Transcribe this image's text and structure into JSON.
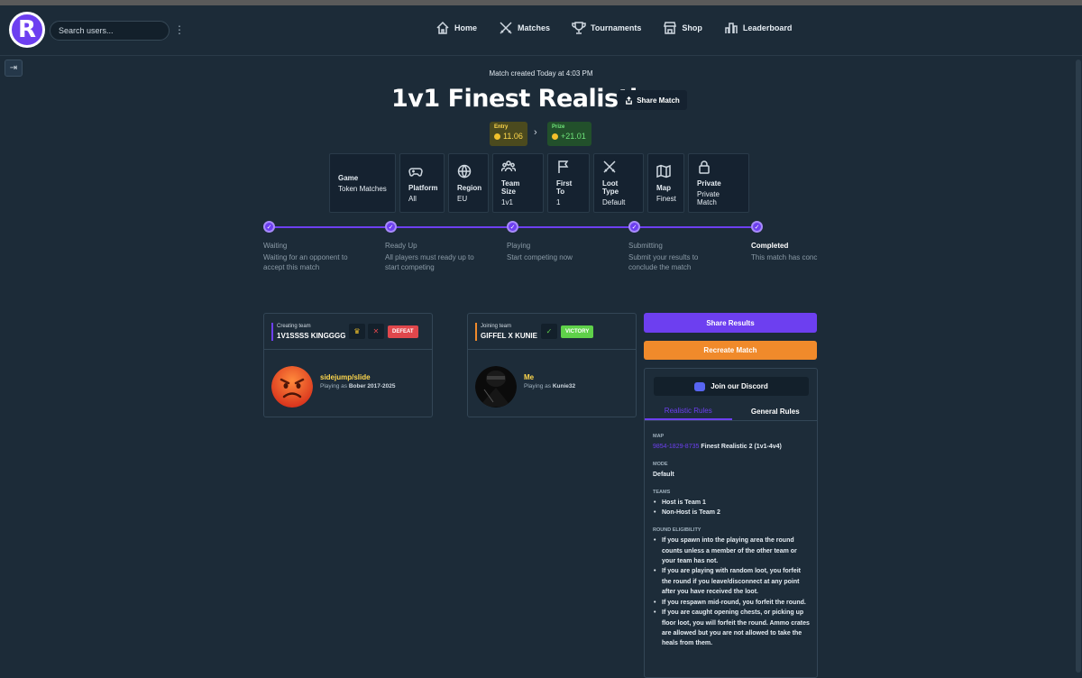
{
  "header": {
    "logo_letter": "R",
    "search_placeholder": "Search users...",
    "menu_icon": "kebab-icon",
    "nav": [
      {
        "label": "Home",
        "icon": "home-icon"
      },
      {
        "label": "Matches",
        "icon": "swords-icon"
      },
      {
        "label": "Tournaments",
        "icon": "trophy-icon"
      },
      {
        "label": "Shop",
        "icon": "shop-icon"
      },
      {
        "label": "Leaderboard",
        "icon": "leaderboard-icon"
      }
    ]
  },
  "match": {
    "created": "Match created Today at 4:03 PM",
    "title": "1v1 Finest Realistic",
    "share_label": "Share Match",
    "entry_label": "Entry",
    "entry_value": "11.06",
    "prize_label": "Prize",
    "prize_value": "+21.01",
    "info": [
      {
        "label": "Game",
        "value": "Token Matches"
      },
      {
        "label": "Platform",
        "value": "All"
      },
      {
        "label": "Region",
        "value": "EU"
      },
      {
        "label": "Team Size",
        "value": "1v1"
      },
      {
        "label": "First To",
        "value": "1"
      },
      {
        "label": "Loot Type",
        "value": "Default"
      },
      {
        "label": "Map",
        "value": "Finest"
      },
      {
        "label": "Private",
        "value": "Private Match"
      }
    ]
  },
  "steps": [
    {
      "title": "Waiting",
      "desc": "Waiting for an opponent to accept this match"
    },
    {
      "title": "Ready Up",
      "desc": "All players must ready up to start competing"
    },
    {
      "title": "Playing",
      "desc": "Start competing now"
    },
    {
      "title": "Submitting",
      "desc": "Submit your results to conclude the match"
    },
    {
      "title": "Completed",
      "desc": "This match has conc"
    }
  ],
  "teams": {
    "creating": {
      "label": "Creating team",
      "name": "1V1SSSS KINGGGG",
      "result": "DEFEAT",
      "player_name": "sidejump/slide",
      "player_sub_prefix": "Playing as",
      "player_as": "Bober 2017-2025"
    },
    "joining": {
      "label": "Joining team",
      "name": "GIFFEL X KUNIE",
      "result": "VICTORY",
      "player_name": "Me",
      "player_sub_prefix": "Playing as",
      "player_as": "Kunie32"
    }
  },
  "actions": {
    "share_results": "Share Results",
    "recreate": "Recreate Match",
    "discord": "Join our Discord"
  },
  "rules": {
    "tabs": [
      "Realistic Rules",
      "General Rules"
    ],
    "map_heading": "MAP",
    "map_code": "9854-1829-8735",
    "map_name": "Finest Realistic 2 (1v1-4v4)",
    "mode_heading": "MODE",
    "mode_value": "Default",
    "teams_heading": "TEAMS",
    "teams": [
      {
        "prefix": "Host is ",
        "value": "Team 1"
      },
      {
        "prefix": "Non-Host is ",
        "value": "Team 2"
      }
    ],
    "round_heading": "ROUND ELIGIBILITY",
    "round_items": [
      "If you spawn into the playing area the round counts unless a member of the other team or your team has not.",
      "If you are playing with random loot, you forfeit the round if you leave/disconnect at any point after you have received the loot.",
      "If you respawn mid-round, you forfeit the round.",
      "If you are caught opening chests, or picking up floor loot, you will forfeit the round. Ammo crates are allowed but you are not allowed to take the heals from them."
    ]
  },
  "colors": {
    "accent": "#6d3ff0",
    "defeat": "#e0474c",
    "victory": "#5fd14a",
    "orange": "#f08a2b"
  }
}
